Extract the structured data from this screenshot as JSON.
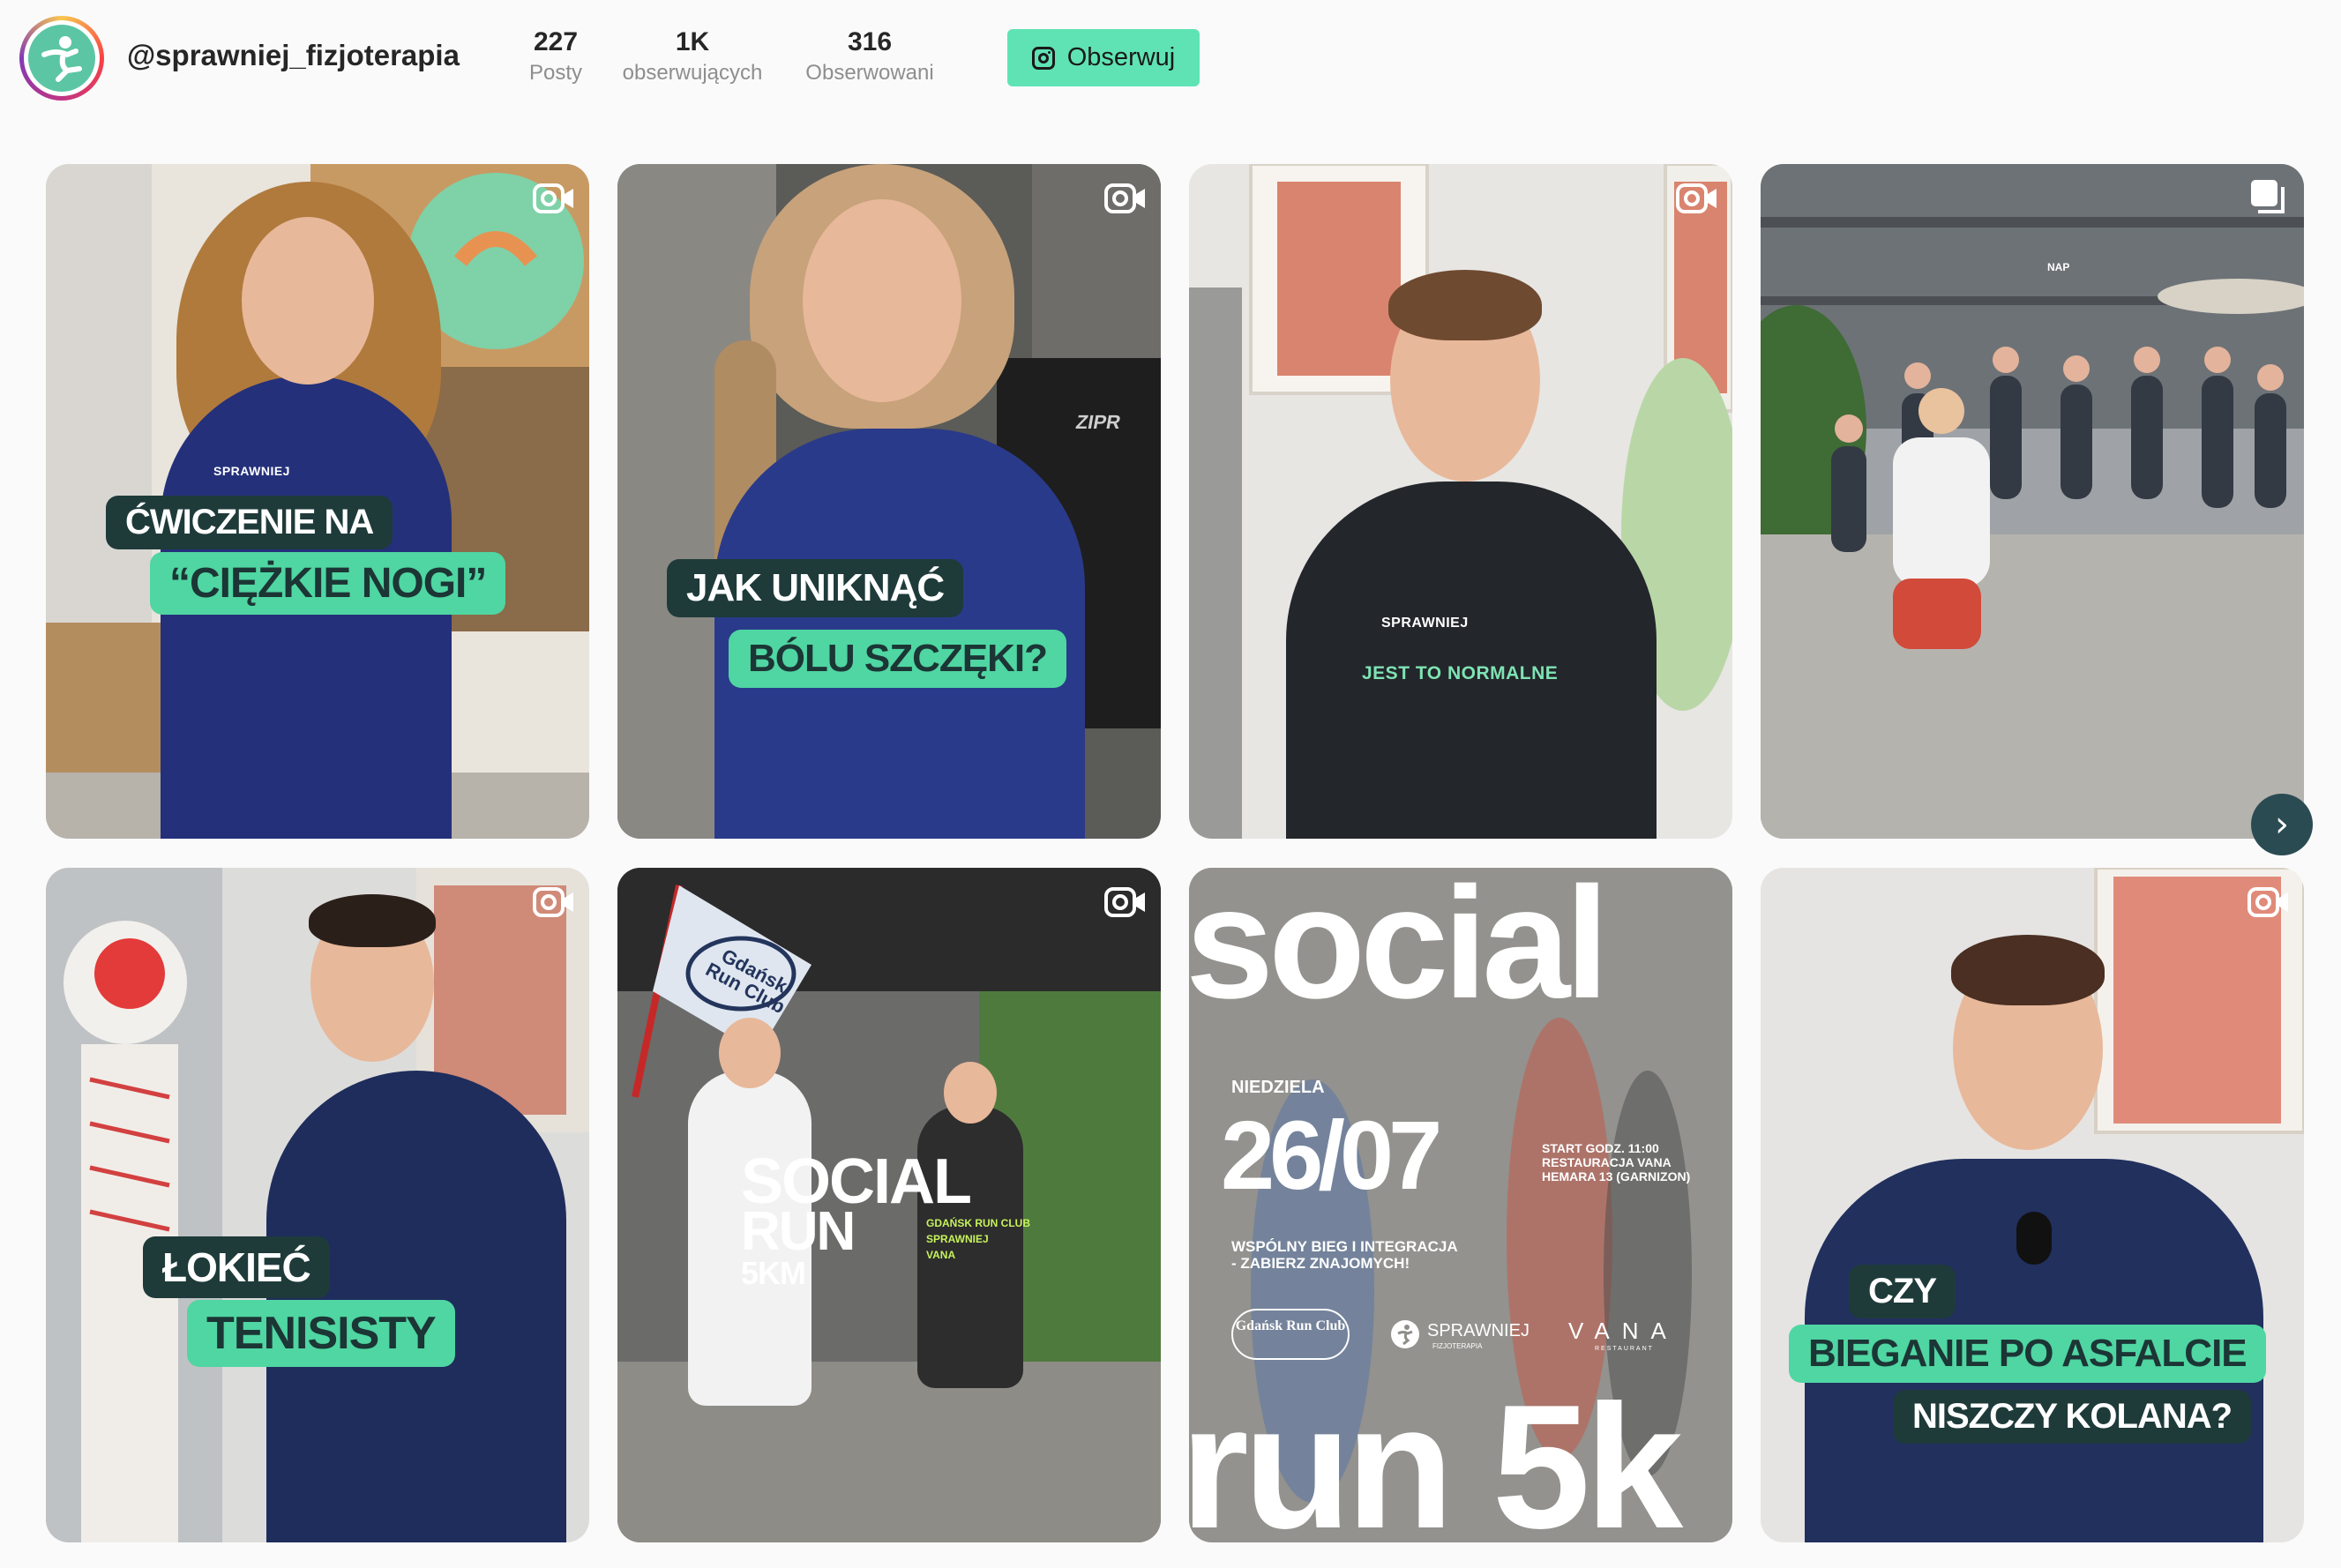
{
  "profile": {
    "username": "@sprawniej_fizjoterapia",
    "follow_label": "Obserwuj",
    "follow_icon": "instagram-icon",
    "avatar_icon": "runner-logo-icon"
  },
  "stats": [
    {
      "value": "227",
      "label": "Posty"
    },
    {
      "value": "1K",
      "label": "obserwujących"
    },
    {
      "value": "316",
      "label": "Obserwowani"
    }
  ],
  "colors": {
    "accent": "#5fe3b5",
    "caption_dark": "#1e3b3a",
    "caption_green": "#4fd6a2"
  },
  "posts": [
    {
      "type": "reel",
      "captions": [
        "ĆWICZENIE NA",
        "“CIĘŻKIE NOGI”"
      ],
      "shirt_text": "SPRAWNIEJ"
    },
    {
      "type": "reel",
      "captions": [
        "JAK UNIKNĄĆ",
        "BÓLU SZCZĘKI?"
      ],
      "background_text": "ZIPR"
    },
    {
      "type": "reel",
      "shirt_brand": "SPRAWNIEJ",
      "captions": [
        "JEST TO NORMALNE"
      ]
    },
    {
      "type": "carousel",
      "sign_text": "NAP"
    },
    {
      "type": "reel",
      "captions": [
        "ŁOKIEĆ",
        "TENISISTY"
      ]
    },
    {
      "type": "reel",
      "flag_text": "Gdańsk Run Club",
      "captions": [
        "SOCIAL",
        "RUN",
        "5KM"
      ],
      "small_lines": [
        "GDAŃSK RUN CLUB",
        "SPRAWNIEJ",
        "VANA"
      ]
    },
    {
      "type": "image",
      "title_top": "social",
      "day": "NIEDZIELA",
      "date": "26/07",
      "details": [
        "START GODZ. 11:00",
        "RESTAURACJA VANA",
        "HEMARA 13 (GARNIZON)"
      ],
      "tagline": [
        "WSPÓLNY BIEG I INTEGRACJA",
        "- ZABIERZ ZNAJOMYCH!"
      ],
      "partners": [
        "Gdańsk Run Club",
        "SPRAWNIEJ",
        "VANA",
        "FIZJOTERAPIA",
        "RESTAURANT"
      ],
      "title_bottom": "run 5k"
    },
    {
      "type": "reel",
      "captions": [
        "CZY",
        "BIEGANIE PO ASFALCIE",
        "NISZCZY KOLANA?"
      ]
    }
  ],
  "nav": {
    "next_icon": "chevron-right-icon",
    "next_label": "›"
  }
}
